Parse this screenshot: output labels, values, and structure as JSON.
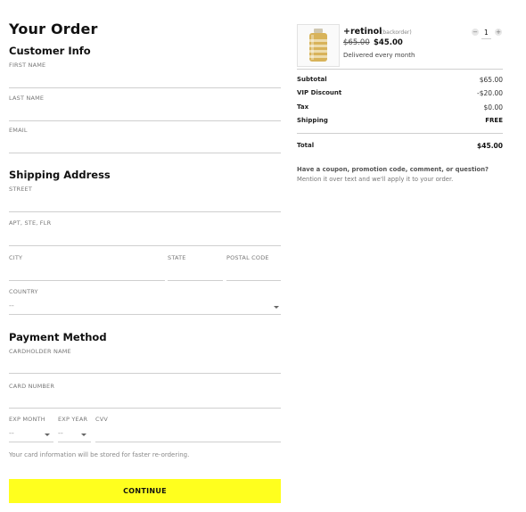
{
  "page": {
    "title": "Your Order"
  },
  "customer_info": {
    "heading": "Customer Info",
    "first_name_label": "FIRST NAME",
    "last_name_label": "LAST NAME",
    "email_label": "EMAIL"
  },
  "shipping": {
    "heading": "Shipping Address",
    "street_label": "STREET",
    "apt_label": "APT, STE, FLR",
    "city_label": "CITY",
    "state_label": "STATE",
    "postal_label": "POSTAL CODE",
    "country_label": "COUNTRY",
    "country_value": "--"
  },
  "payment": {
    "heading": "Payment Method",
    "cardholder_label": "CARDHOLDER NAME",
    "card_number_label": "CARD NUMBER",
    "exp_month_label": "EXP MONTH",
    "exp_month_value": "--",
    "exp_year_label": "EXP YEAR",
    "exp_year_value": "--",
    "cvv_label": "CVV",
    "note": "Your card information will be stored for faster re-ordering."
  },
  "continue_button": {
    "label": "CONTINUE"
  },
  "product": {
    "name": "+retinol",
    "status": "(backorder)",
    "original_price": "$65.00",
    "price": "$45.00",
    "delivery": "Delivered every month",
    "quantity": "1",
    "minus": "−",
    "plus": "+"
  },
  "summary": {
    "rows": [
      {
        "label": "Subtotal",
        "value": "$65.00"
      },
      {
        "label": "VIP Discount",
        "value": "-$20.00"
      },
      {
        "label": "Tax",
        "value": "$0.00"
      },
      {
        "label": "Shipping",
        "value": "FREE"
      }
    ],
    "total_label": "Total",
    "total_value": "$45.00"
  },
  "coupon": {
    "question": "Have a coupon, promotion code, comment, or question?",
    "text": "Mention it over text and we'll apply it to your order."
  },
  "colors": {
    "accent": "#ffff1e",
    "divider": "#cfcfcf"
  }
}
